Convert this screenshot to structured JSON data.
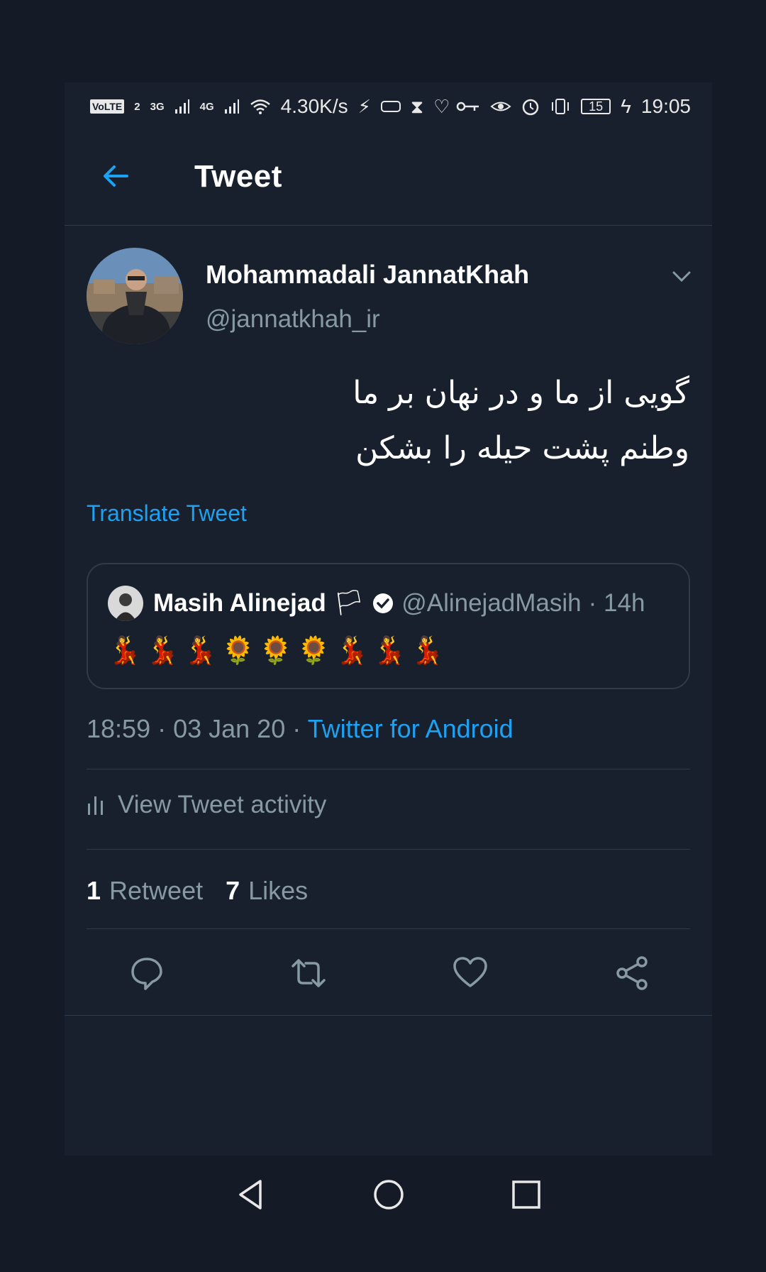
{
  "status_bar": {
    "volte": "VoLTE",
    "sim": "2",
    "net1": "3G",
    "net2": "4G",
    "speed": "4.30K/s",
    "battery": "15",
    "time": "19:05"
  },
  "header": {
    "title": "Tweet"
  },
  "tweet": {
    "author_name": "Mohammadali JannatKhah",
    "author_handle": "@jannatkhah_ir",
    "text_line1": "گویی از ما و در نهان بر ما",
    "text_line2": "وطنم پشت حیله را بشکن",
    "translate_label": "Translate Tweet",
    "time": "18:59 · 03 Jan 20 · ",
    "source": "Twitter for Android",
    "activity_label": "View Tweet activity",
    "retweet_count": "1",
    "retweet_label": "Retweet",
    "like_count": "7",
    "like_label": "Likes"
  },
  "quoted": {
    "name": "Masih Alinejad",
    "flag": "🏳",
    "handle": "@AlinejadMasih",
    "age": "· 14h",
    "emojis": [
      "💃",
      "💃",
      "💃",
      "🌻",
      "🌻",
      "🌻",
      "💃",
      "💃",
      "💃"
    ]
  },
  "icons": {
    "back": "arrow-left",
    "caret": "chevron-down",
    "verified": "check-badge",
    "reply": "speech-bubble",
    "retweet": "retweet-arrows",
    "like": "heart",
    "share": "share-nodes"
  },
  "colors": {
    "background": "#17202c",
    "accent": "#1da1f2",
    "muted": "#8899a6",
    "border": "#2f3b4a"
  }
}
